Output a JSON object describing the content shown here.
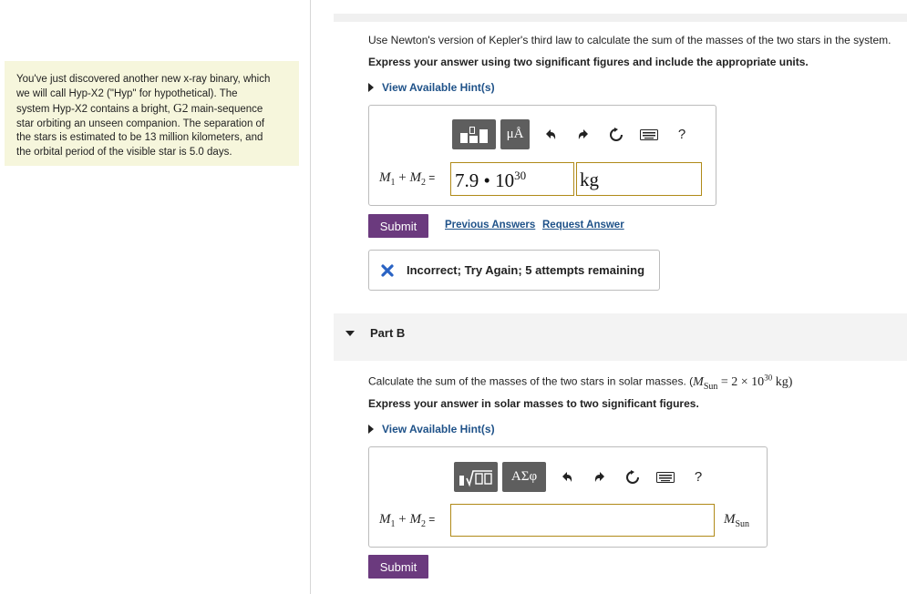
{
  "problem": {
    "lines": [
      "You've just discovered another new x-ray binary, which",
      "we will call Hyp-X2 (\"Hyp\" for hypothetical). The",
      "main-sequence",
      "star orbiting an unseen companion. The separation of",
      "the stars is estimated to be 13 million kilometers, and",
      "the orbital period of the visible star is 5.0 days."
    ],
    "line3_prefix": "system Hyp-X2 contains a bright,",
    "line3_star": "G2"
  },
  "partA": {
    "question": "Use Newton's version of Kepler's third law to calculate the sum of the masses of the two stars in the system.",
    "instruction": "Express your answer using two significant figures and include the appropriate units.",
    "hint_label": "View Available Hint(s)",
    "toolbar": {
      "btn2": "μÅ",
      "help": "?"
    },
    "eq_m1": "M",
    "eq_sub1": "1",
    "eq_plus": " + ",
    "eq_m2": "M",
    "eq_sub2": "2",
    "eq_equals": " =",
    "value_mantissa": "7.9 • 10",
    "value_exponent": "30",
    "unit_value": "kg",
    "submit_label": "Submit",
    "previous_answers": "Previous Answers",
    "request_answer": "Request Answer",
    "feedback": "Incorrect; Try Again; 5 attempts remaining"
  },
  "partB": {
    "label": "Part B",
    "question_prefix": "Calculate the sum of the masses of the two stars in solar masses. (",
    "question_msun": "M",
    "question_msun_sub": "Sun",
    "question_rest": " = 2 × 10",
    "question_exp": "30",
    "question_suffix": " kg)",
    "instruction": "Express your answer in solar masses to two significant figures.",
    "hint_label": "View Available Hint(s)",
    "toolbar": {
      "btn2": "ΑΣφ",
      "help": "?"
    },
    "answer_value": "",
    "unit_m": "M",
    "unit_sub": "Sun",
    "submit_label": "Submit"
  },
  "colors": {
    "accent": "#6b3a7e",
    "link": "#1f5289",
    "field_border": "#b08a18",
    "error": "#2a63c4",
    "problem_bg": "#f6f6dc"
  },
  "icons": [
    "templates-icon",
    "undo-icon",
    "redo-icon",
    "reset-icon",
    "keyboard-icon",
    "help-icon",
    "incorrect-x-icon"
  ]
}
